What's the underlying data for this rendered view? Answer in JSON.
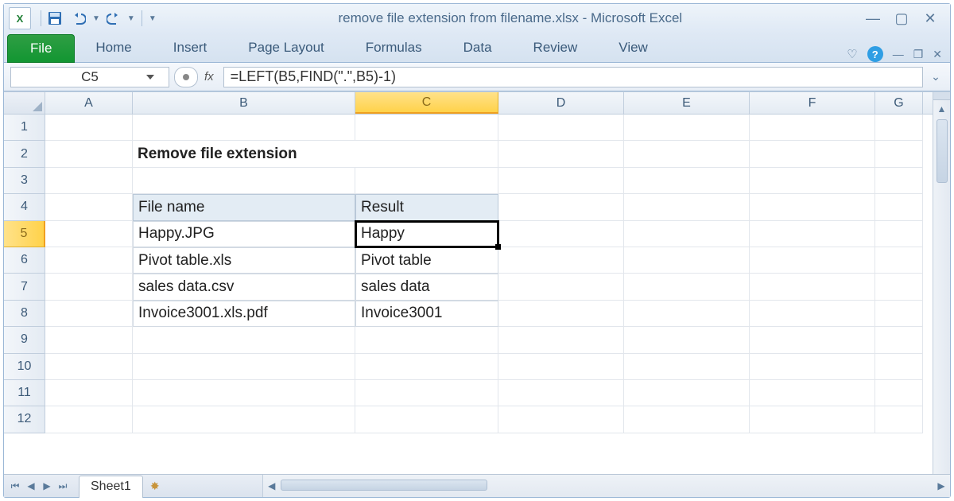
{
  "title": "remove file extension from filename.xlsx  -  Microsoft Excel",
  "ribbon": {
    "file": "File",
    "tabs": [
      "Home",
      "Insert",
      "Page Layout",
      "Formulas",
      "Data",
      "Review",
      "View"
    ]
  },
  "name_box": "C5",
  "fx_label": "fx",
  "formula": "=LEFT(B5,FIND(\".\",B5)-1)",
  "columns": [
    "A",
    "B",
    "C",
    "D",
    "E",
    "F",
    "G"
  ],
  "active_col": "C",
  "rows": [
    "1",
    "2",
    "3",
    "4",
    "5",
    "6",
    "7",
    "8",
    "9",
    "10",
    "11",
    "12"
  ],
  "active_row": "5",
  "sheet_tab": "Sheet1",
  "content": {
    "title_cell": "Remove file extension",
    "headers": {
      "filename": "File name",
      "result": "Result"
    },
    "data": [
      {
        "filename": "Happy.JPG",
        "result": "Happy"
      },
      {
        "filename": "Pivot table.xls",
        "result": "Pivot table"
      },
      {
        "filename": "sales data.csv",
        "result": "sales data"
      },
      {
        "filename": "Invoice3001.xls.pdf",
        "result": "Invoice3001"
      }
    ]
  }
}
